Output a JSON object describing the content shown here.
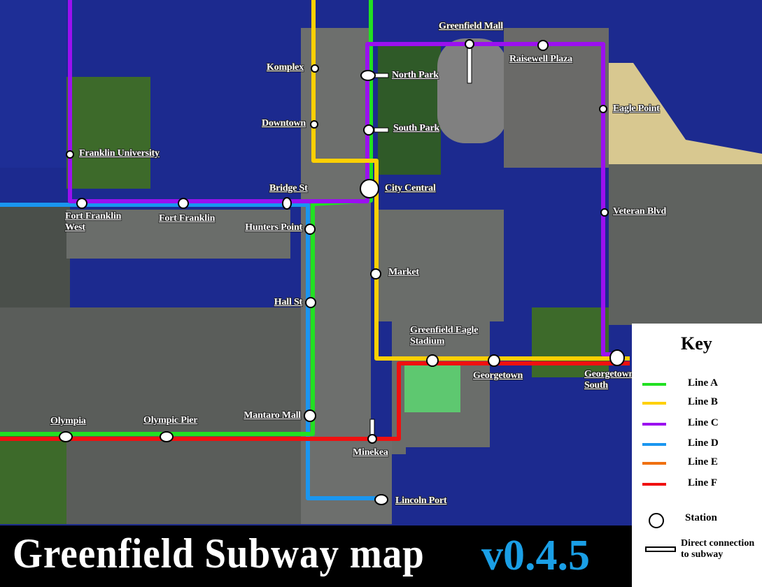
{
  "title": "Greenfield Subway map",
  "version": "v0.4.5",
  "colors": {
    "line_a": "#22e022",
    "line_b": "#ffd000",
    "line_c": "#9b10f0",
    "line_d": "#1a96f0",
    "line_e": "#f07010",
    "line_f": "#f01010",
    "water": "#1c2a8f",
    "version_text": "#1a9fe6"
  },
  "stations": {
    "komplex": "Komplex",
    "downtown": "Downtown",
    "franklin_university": "Franklin University",
    "fort_franklin_west": "Fort Franklin West",
    "fort_franklin": "Fort Franklin",
    "bridge_st": "Bridge St",
    "hunters_point": "Hunters Point",
    "city_central": "City Central",
    "north_park": "North Park",
    "south_park": "South Park",
    "greenfield_mall": "Greenfield Mall",
    "raisewell_plaza": "Raisewell Plaza",
    "eagle_point": "Eagle Point",
    "veteran_blvd": "Veteran Blvd",
    "market": "Market",
    "hall_st": "Hall St",
    "greenfield_eagle_stadium": "Greenfield Eagle Stadium",
    "georgetown": "Georgetown",
    "georgetown_south": "Georgetown South",
    "mantaro_mall": "Mantaro Mall",
    "olympia": "Olympia",
    "olympic_pier": "Olympic Pier",
    "minekea": "Minekea",
    "lincoln_port": "Lincoln Port"
  },
  "key": {
    "title": "Key",
    "lines": [
      "Line A",
      "Line B",
      "Line C",
      "Line D",
      "Line E",
      "Line F"
    ],
    "station": "Station",
    "direct_connection": "Direct connection to subway"
  }
}
